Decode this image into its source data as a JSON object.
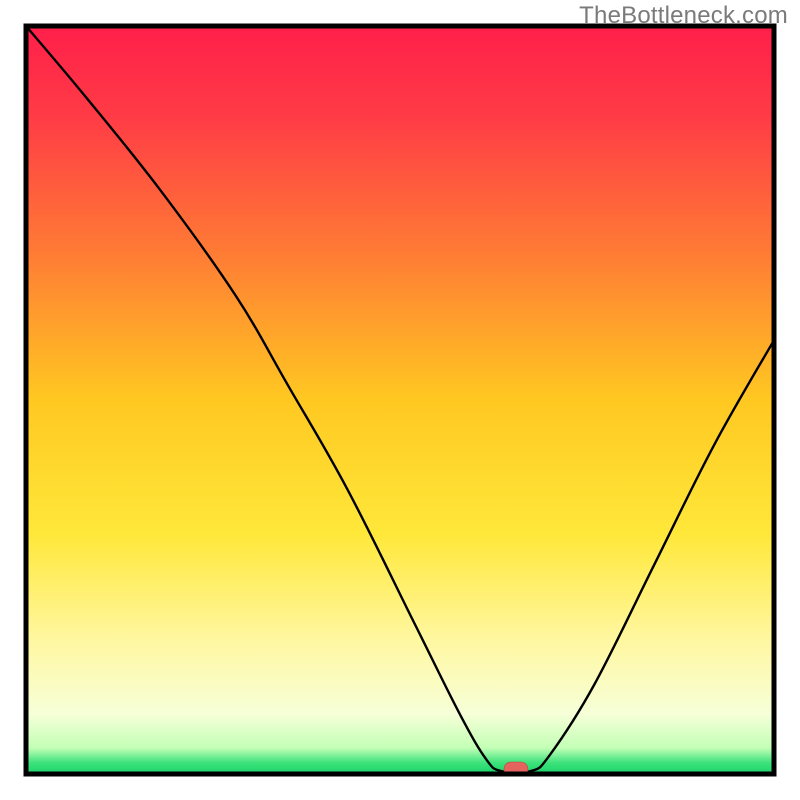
{
  "watermark": "TheBottleneck.com",
  "chart_data": {
    "type": "line",
    "title": "",
    "xlabel": "",
    "ylabel": "",
    "xlim": [
      0,
      100
    ],
    "ylim": [
      0,
      100
    ],
    "grid": false,
    "note": "Axes are bare (no ticks, no numeric labels). The background is a vertical heat gradient (red→orange→yellow→pale-yellow→green). A single black V-shaped curve dips to a minimum near x≈64-67% where a small red marker pill sits on the baseline. Values below are estimated as percentages of the plot area (0 = bottom/left, 100 = top/right).",
    "background_gradient_stops": [
      {
        "offset": 0.0,
        "color": "#ff1f4a"
      },
      {
        "offset": 0.12,
        "color": "#ff3b46"
      },
      {
        "offset": 0.3,
        "color": "#ff7a35"
      },
      {
        "offset": 0.5,
        "color": "#ffc821"
      },
      {
        "offset": 0.68,
        "color": "#ffe83a"
      },
      {
        "offset": 0.82,
        "color": "#fff7a0"
      },
      {
        "offset": 0.92,
        "color": "#f6ffd8"
      },
      {
        "offset": 0.965,
        "color": "#c3ffb6"
      },
      {
        "offset": 0.985,
        "color": "#3de27b"
      },
      {
        "offset": 1.0,
        "color": "#19d36a"
      }
    ],
    "series": [
      {
        "name": "bottleneck-curve",
        "points": [
          {
            "x": 0.0,
            "y": 100.0
          },
          {
            "x": 8.0,
            "y": 90.5
          },
          {
            "x": 18.0,
            "y": 78.0
          },
          {
            "x": 28.0,
            "y": 64.0
          },
          {
            "x": 35.0,
            "y": 52.0
          },
          {
            "x": 43.0,
            "y": 38.0
          },
          {
            "x": 52.0,
            "y": 20.0
          },
          {
            "x": 58.0,
            "y": 8.0
          },
          {
            "x": 61.5,
            "y": 2.0
          },
          {
            "x": 63.5,
            "y": 0.4
          },
          {
            "x": 67.5,
            "y": 0.4
          },
          {
            "x": 70.0,
            "y": 2.5
          },
          {
            "x": 76.0,
            "y": 12.0
          },
          {
            "x": 84.0,
            "y": 28.0
          },
          {
            "x": 92.0,
            "y": 44.0
          },
          {
            "x": 100.0,
            "y": 58.0
          }
        ]
      }
    ],
    "marker": {
      "x_center": 65.5,
      "width_pct": 3.2,
      "color": "#e4635f"
    }
  }
}
